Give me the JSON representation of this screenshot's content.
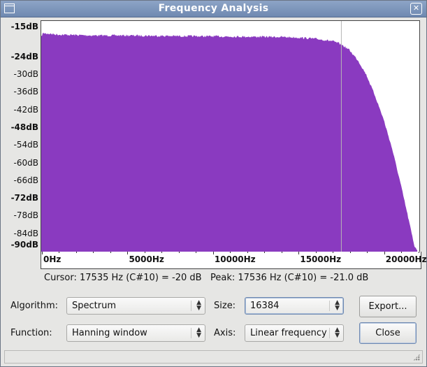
{
  "window": {
    "title": "Frequency Analysis"
  },
  "icons": {
    "window_menu": "window-menu-icon",
    "close": "close-icon",
    "dropdown": "updown-arrows-icon",
    "resize": "resize-grip-icon"
  },
  "colors": {
    "spectrum_fill": "#8a3ac0",
    "cursor_line": "#b6b6b6",
    "titlebar": "#7d95bb"
  },
  "chart_data": {
    "type": "area",
    "title": "",
    "xlabel": "",
    "ylabel": "",
    "xlim": [
      0,
      22050
    ],
    "ylim": [
      -90,
      -15
    ],
    "x_tick_labels": [
      "0Hz",
      "5000Hz",
      "10000Hz",
      "15000Hz",
      "20000Hz"
    ],
    "y_tick_labels": [
      "-15dB",
      "-24dB",
      "-30dB",
      "-36dB",
      "-42dB",
      "-48dB",
      "-54dB",
      "-60dB",
      "-66dB",
      "-72dB",
      "-78dB",
      "-84dB",
      "-90dB"
    ],
    "y_tick_values": [
      -15,
      -24,
      -30,
      -36,
      -42,
      -48,
      -54,
      -60,
      -66,
      -72,
      -78,
      -84,
      -90
    ],
    "y_major_ticks": [
      -15,
      -24,
      -48,
      -72,
      -90
    ],
    "cursor_hz": 17535,
    "series": [
      {
        "x": [
          0,
          100,
          1000,
          3000,
          5000,
          8000,
          10000,
          12000,
          14000,
          15000,
          16000,
          17000,
          17500,
          18000,
          18500,
          19000,
          19500,
          20000,
          20500,
          21000,
          21500,
          21800,
          22050
        ],
        "values": [
          -17,
          -15.8,
          -16.3,
          -16.6,
          -16.6,
          -16.8,
          -16.9,
          -17.0,
          -17.1,
          -17.3,
          -17.7,
          -18.5,
          -19.5,
          -21.5,
          -25.0,
          -30.0,
          -37.0,
          -45.0,
          -55.0,
          -67.0,
          -80.0,
          -88.0,
          -90.0
        ]
      }
    ]
  },
  "readout": {
    "cursor": "Cursor: 17535 Hz (C#10) = -20 dB",
    "peak": "Peak: 17536 Hz (C#10) = -21.0 dB"
  },
  "controls": {
    "algorithm_label": "Algorithm:",
    "algorithm_value": "Spectrum",
    "size_label": "Size:",
    "size_value": "16384",
    "function_label": "Function:",
    "function_value": "Hanning window",
    "axis_label": "Axis:",
    "axis_value": "Linear frequency",
    "export_label": "Export...",
    "close_label": "Close"
  }
}
